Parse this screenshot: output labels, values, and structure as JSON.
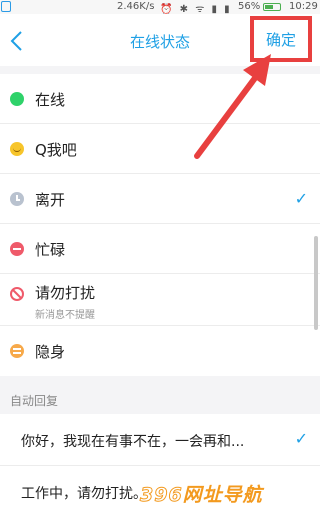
{
  "status_bar": {
    "speed": "2.46K/s",
    "icons": "⏰ ✱ ᯤ ▮ ▮",
    "battery_pct": "56%",
    "time": "10:29"
  },
  "header": {
    "title": "在线状态",
    "confirm_label": "确定"
  },
  "status_items": [
    {
      "label": "在线",
      "sub": "",
      "checked": false,
      "icon": "online-dot"
    },
    {
      "label": "Q我吧",
      "sub": "",
      "checked": false,
      "icon": "smile-face"
    },
    {
      "label": "离开",
      "sub": "",
      "checked": true,
      "icon": "clock"
    },
    {
      "label": "忙碌",
      "sub": "",
      "checked": false,
      "icon": "busy-minus"
    },
    {
      "label": "请勿打扰",
      "sub": "新消息不提醒",
      "checked": false,
      "icon": "no-entry"
    },
    {
      "label": "隐身",
      "sub": "",
      "checked": false,
      "icon": "invisible"
    }
  ],
  "check_mark": "✓",
  "auto_reply": {
    "section_title": "自动回复",
    "items": [
      {
        "label": "你好，我现在有事不在，一会再和...",
        "checked": true
      },
      {
        "label": "工作中，请勿打扰。",
        "checked": false
      }
    ]
  },
  "watermark": {
    "digits": "396",
    "text": "网址导航"
  },
  "colors": {
    "accent": "#1fa0e5",
    "annotation": "#e8403f",
    "online": "#2fd26a",
    "busy": "#ef5a6a",
    "invisible": "#f7a94a"
  }
}
